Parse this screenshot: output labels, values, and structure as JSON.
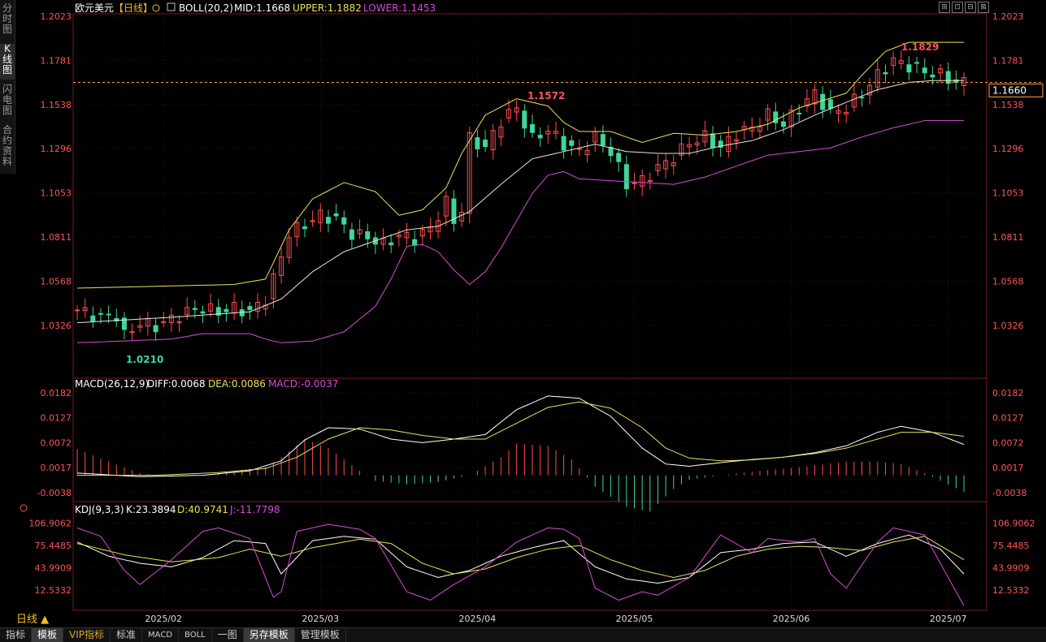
{
  "side_tabs": [
    "分时图",
    "K线图",
    "闪电图",
    "合约资料"
  ],
  "side_tabs_active": 1,
  "toolbar": [
    "⊞",
    "⊡",
    "⊟",
    "⊠"
  ],
  "header": {
    "symbol": "欧元美元",
    "period_tag": "【日线】",
    "boll_label": "BOLL(20,2)",
    "mid": "MID:1.1668",
    "upper": "UPPER:1.1882",
    "lower": "LOWER:1.1453"
  },
  "macd_header": {
    "label": "MACD(26,12,9)",
    "diff": "DIFF:0.0068",
    "dea": "DEA:0.0086",
    "macd": "MACD:-0.0037"
  },
  "kdj_header": {
    "label": "KDJ(9,3,3)",
    "k": "K:23.3894",
    "d": "D:40.9741",
    "j": "J:-11.7798"
  },
  "period_button": "日线 ▲",
  "bottom_tabs": [
    "指标",
    "模板",
    "VIP指标",
    "标准",
    "MACD",
    "BOLL",
    "一图",
    "另存模板",
    "管理模板"
  ],
  "colors": {
    "up": "#ff4d4d",
    "down": "#3ed69a",
    "boll_upper": "#e8e35a",
    "boll_mid": "#e8e8d0",
    "boll_lower": "#d84cd8",
    "dea": "#e8e35a",
    "diff": "#ffffff",
    "kdj_k": "#ffffff",
    "kdj_d": "#e8e35a",
    "kdj_j": "#d84cd8",
    "axis_text": "#ff5555",
    "last_price": "#ffa040"
  },
  "chart_data": [
    {
      "type": "candlestick",
      "title": "欧元美元 日线",
      "x_ticks": [
        "2025/02",
        "2025/03",
        "2025/04",
        "2025/05",
        "2025/06",
        "2025/07"
      ],
      "x_tick_index": [
        11,
        31,
        51,
        71,
        91,
        111
      ],
      "y_ticks": [
        "1.2023",
        "1.1781",
        "1.1538",
        "1.1296",
        "1.1053",
        "1.0811",
        "1.0568",
        "1.0326"
      ],
      "ylim": [
        1.0169,
        1.2023
      ],
      "last_price": "1.1660",
      "high_label": "1.1829",
      "low_label": "1.0210",
      "mid_high_label": "1.1572",
      "close_anchors": [
        [
          0,
          1.041
        ],
        [
          3,
          1.037
        ],
        [
          5,
          1.038
        ],
        [
          6,
          1.027
        ],
        [
          8,
          1.034
        ],
        [
          10,
          1.032
        ],
        [
          12,
          1.036
        ],
        [
          14,
          1.04
        ],
        [
          16,
          1.042
        ],
        [
          18,
          1.04
        ],
        [
          20,
          1.042
        ],
        [
          22,
          1.04
        ],
        [
          24,
          1.047
        ],
        [
          25,
          1.058
        ],
        [
          27,
          1.083
        ],
        [
          29,
          1.088
        ],
        [
          31,
          1.093
        ],
        [
          33,
          1.091
        ],
        [
          35,
          1.083
        ],
        [
          37,
          1.081
        ],
        [
          39,
          1.077
        ],
        [
          41,
          1.082
        ],
        [
          43,
          1.08
        ],
        [
          45,
          1.086
        ],
        [
          47,
          1.1
        ],
        [
          48,
          1.09
        ],
        [
          49,
          1.096
        ],
        [
          50,
          1.135
        ],
        [
          52,
          1.13
        ],
        [
          54,
          1.145
        ],
        [
          56,
          1.152
        ],
        [
          58,
          1.135
        ],
        [
          60,
          1.14
        ],
        [
          62,
          1.132
        ],
        [
          64,
          1.128
        ],
        [
          66,
          1.136
        ],
        [
          68,
          1.128
        ],
        [
          70,
          1.11
        ],
        [
          72,
          1.112
        ],
        [
          74,
          1.119
        ],
        [
          76,
          1.125
        ],
        [
          78,
          1.133
        ],
        [
          80,
          1.136
        ],
        [
          82,
          1.13
        ],
        [
          84,
          1.138
        ],
        [
          86,
          1.141
        ],
        [
          88,
          1.148
        ],
        [
          90,
          1.143
        ],
        [
          92,
          1.152
        ],
        [
          94,
          1.16
        ],
        [
          96,
          1.149
        ],
        [
          98,
          1.152
        ],
        [
          100,
          1.16
        ],
        [
          102,
          1.17
        ],
        [
          104,
          1.178
        ],
        [
          106,
          1.175
        ],
        [
          108,
          1.172
        ],
        [
          110,
          1.17
        ],
        [
          112,
          1.166
        ],
        [
          113,
          1.166
        ]
      ],
      "boll_upper_anchors": [
        [
          0,
          1.053
        ],
        [
          20,
          1.055
        ],
        [
          24,
          1.058
        ],
        [
          27,
          1.085
        ],
        [
          30,
          1.102
        ],
        [
          34,
          1.111
        ],
        [
          38,
          1.106
        ],
        [
          41,
          1.093
        ],
        [
          44,
          1.096
        ],
        [
          47,
          1.108
        ],
        [
          49,
          1.127
        ],
        [
          52,
          1.148
        ],
        [
          56,
          1.157
        ],
        [
          60,
          1.153
        ],
        [
          62,
          1.144
        ],
        [
          64,
          1.139
        ],
        [
          68,
          1.139
        ],
        [
          72,
          1.133
        ],
        [
          76,
          1.138
        ],
        [
          80,
          1.137
        ],
        [
          84,
          1.139
        ],
        [
          88,
          1.143
        ],
        [
          92,
          1.152
        ],
        [
          95,
          1.156
        ],
        [
          98,
          1.16
        ],
        [
          100,
          1.17
        ],
        [
          103,
          1.183
        ],
        [
          106,
          1.188
        ],
        [
          113,
          1.188
        ]
      ],
      "boll_mid_anchors": [
        [
          0,
          1.034
        ],
        [
          12,
          1.037
        ],
        [
          22,
          1.04
        ],
        [
          26,
          1.047
        ],
        [
          30,
          1.062
        ],
        [
          34,
          1.073
        ],
        [
          38,
          1.079
        ],
        [
          42,
          1.085
        ],
        [
          46,
          1.087
        ],
        [
          50,
          1.095
        ],
        [
          54,
          1.11
        ],
        [
          58,
          1.124
        ],
        [
          62,
          1.128
        ],
        [
          66,
          1.132
        ],
        [
          70,
          1.128
        ],
        [
          74,
          1.127
        ],
        [
          78,
          1.127
        ],
        [
          82,
          1.131
        ],
        [
          86,
          1.134
        ],
        [
          90,
          1.14
        ],
        [
          94,
          1.148
        ],
        [
          98,
          1.155
        ],
        [
          102,
          1.162
        ],
        [
          106,
          1.166
        ],
        [
          109,
          1.167
        ],
        [
          113,
          1.167
        ]
      ],
      "boll_lower_anchors": [
        [
          0,
          1.023
        ],
        [
          12,
          1.025
        ],
        [
          16,
          1.028
        ],
        [
          22,
          1.028
        ],
        [
          24,
          1.025
        ],
        [
          26,
          1.023
        ],
        [
          30,
          1.024
        ],
        [
          34,
          1.029
        ],
        [
          38,
          1.043
        ],
        [
          40,
          1.058
        ],
        [
          42,
          1.076
        ],
        [
          44,
          1.077
        ],
        [
          46,
          1.073
        ],
        [
          48,
          1.063
        ],
        [
          50,
          1.055
        ],
        [
          52,
          1.062
        ],
        [
          54,
          1.075
        ],
        [
          56,
          1.09
        ],
        [
          58,
          1.105
        ],
        [
          60,
          1.115
        ],
        [
          62,
          1.117
        ],
        [
          64,
          1.113
        ],
        [
          68,
          1.112
        ],
        [
          72,
          1.111
        ],
        [
          76,
          1.11
        ],
        [
          80,
          1.114
        ],
        [
          84,
          1.12
        ],
        [
          88,
          1.126
        ],
        [
          92,
          1.128
        ],
        [
          96,
          1.13
        ],
        [
          100,
          1.136
        ],
        [
          104,
          1.141
        ],
        [
          108,
          1.145
        ],
        [
          113,
          1.145
        ]
      ]
    },
    {
      "type": "macd",
      "y_ticks": [
        "0.0182",
        "0.0127",
        "0.0072",
        "0.0017",
        "-0.0038"
      ],
      "ylim": [
        -0.0058,
        0.0182
      ],
      "diff_anchors": [
        [
          0,
          0.0005
        ],
        [
          8,
          -0.0003
        ],
        [
          16,
          0.0
        ],
        [
          22,
          0.001
        ],
        [
          26,
          0.0032
        ],
        [
          29,
          0.0078
        ],
        [
          32,
          0.0105
        ],
        [
          36,
          0.0102
        ],
        [
          40,
          0.008
        ],
        [
          44,
          0.0072
        ],
        [
          48,
          0.008
        ],
        [
          52,
          0.009
        ],
        [
          56,
          0.0145
        ],
        [
          60,
          0.0175
        ],
        [
          64,
          0.017
        ],
        [
          68,
          0.013
        ],
        [
          72,
          0.006
        ],
        [
          75,
          0.0025
        ],
        [
          78,
          0.002
        ],
        [
          82,
          0.0028
        ],
        [
          86,
          0.0035
        ],
        [
          90,
          0.004
        ],
        [
          94,
          0.005
        ],
        [
          98,
          0.0065
        ],
        [
          102,
          0.0095
        ],
        [
          105,
          0.0108
        ],
        [
          109,
          0.0095
        ],
        [
          113,
          0.0068
        ]
      ],
      "dea_anchors": [
        [
          0,
          0.0
        ],
        [
          10,
          0.0
        ],
        [
          18,
          0.0006
        ],
        [
          24,
          0.0015
        ],
        [
          28,
          0.004
        ],
        [
          32,
          0.008
        ],
        [
          36,
          0.0105
        ],
        [
          40,
          0.01
        ],
        [
          44,
          0.0088
        ],
        [
          48,
          0.008
        ],
        [
          52,
          0.008
        ],
        [
          56,
          0.0115
        ],
        [
          60,
          0.015
        ],
        [
          64,
          0.0162
        ],
        [
          68,
          0.0148
        ],
        [
          72,
          0.0105
        ],
        [
          75,
          0.006
        ],
        [
          78,
          0.0038
        ],
        [
          82,
          0.0032
        ],
        [
          86,
          0.0034
        ],
        [
          90,
          0.004
        ],
        [
          94,
          0.0048
        ],
        [
          98,
          0.006
        ],
        [
          102,
          0.008
        ],
        [
          105,
          0.0095
        ],
        [
          109,
          0.0095
        ],
        [
          113,
          0.0086
        ]
      ],
      "macd_anchors": [
        [
          0,
          0.0058
        ],
        [
          4,
          0.003
        ],
        [
          8,
          0.0005
        ],
        [
          12,
          -0.0003
        ],
        [
          16,
          0.0
        ],
        [
          20,
          0.001
        ],
        [
          24,
          0.0018
        ],
        [
          26,
          0.004
        ],
        [
          29,
          0.008
        ],
        [
          32,
          0.006
        ],
        [
          36,
          0.001
        ],
        [
          38,
          -0.0012
        ],
        [
          42,
          -0.002
        ],
        [
          46,
          -0.0015
        ],
        [
          50,
          0.0
        ],
        [
          54,
          0.004
        ],
        [
          56,
          0.007
        ],
        [
          60,
          0.0065
        ],
        [
          63,
          0.0035
        ],
        [
          66,
          -0.0025
        ],
        [
          70,
          -0.007
        ],
        [
          73,
          -0.008
        ],
        [
          76,
          -0.003
        ],
        [
          78,
          -0.001
        ],
        [
          82,
          0.0
        ],
        [
          86,
          0.0008
        ],
        [
          92,
          0.0018
        ],
        [
          98,
          0.003
        ],
        [
          102,
          0.003
        ],
        [
          105,
          0.0025
        ],
        [
          108,
          0.0005
        ],
        [
          113,
          -0.0037
        ]
      ]
    },
    {
      "type": "kdj",
      "y_ticks": [
        "106.9062",
        "75.4485",
        "43.9909",
        "12.5332"
      ],
      "ylim": [
        -11.78,
        113.0
      ],
      "k_anchors": [
        [
          0,
          80
        ],
        [
          4,
          60
        ],
        [
          8,
          50
        ],
        [
          12,
          45
        ],
        [
          16,
          58
        ],
        [
          20,
          82
        ],
        [
          24,
          78
        ],
        [
          26,
          35
        ],
        [
          30,
          82
        ],
        [
          34,
          88
        ],
        [
          38,
          84
        ],
        [
          42,
          45
        ],
        [
          46,
          30
        ],
        [
          50,
          40
        ],
        [
          54,
          60
        ],
        [
          58,
          72
        ],
        [
          62,
          82
        ],
        [
          66,
          45
        ],
        [
          70,
          28
        ],
        [
          74,
          22
        ],
        [
          78,
          30
        ],
        [
          82,
          65
        ],
        [
          86,
          70
        ],
        [
          90,
          78
        ],
        [
          94,
          80
        ],
        [
          98,
          60
        ],
        [
          102,
          78
        ],
        [
          106,
          90
        ],
        [
          110,
          70
        ],
        [
          113,
          35
        ]
      ],
      "d_anchors": [
        [
          0,
          78
        ],
        [
          6,
          62
        ],
        [
          12,
          52
        ],
        [
          18,
          58
        ],
        [
          22,
          70
        ],
        [
          26,
          60
        ],
        [
          30,
          72
        ],
        [
          36,
          84
        ],
        [
          40,
          78
        ],
        [
          44,
          50
        ],
        [
          48,
          35
        ],
        [
          52,
          42
        ],
        [
          56,
          58
        ],
        [
          60,
          70
        ],
        [
          64,
          75
        ],
        [
          68,
          55
        ],
        [
          72,
          40
        ],
        [
          76,
          30
        ],
        [
          80,
          40
        ],
        [
          84,
          60
        ],
        [
          88,
          70
        ],
        [
          92,
          74
        ],
        [
          96,
          72
        ],
        [
          100,
          68
        ],
        [
          104,
          80
        ],
        [
          108,
          88
        ],
        [
          113,
          55
        ]
      ],
      "j_anchors": [
        [
          0,
          100
        ],
        [
          3,
          88
        ],
        [
          6,
          40
        ],
        [
          8,
          20
        ],
        [
          12,
          55
        ],
        [
          16,
          95
        ],
        [
          18,
          100
        ],
        [
          22,
          85
        ],
        [
          25,
          2
        ],
        [
          26,
          10
        ],
        [
          28,
          95
        ],
        [
          32,
          105
        ],
        [
          36,
          98
        ],
        [
          38,
          85
        ],
        [
          42,
          10
        ],
        [
          45,
          -2
        ],
        [
          48,
          20
        ],
        [
          52,
          45
        ],
        [
          56,
          80
        ],
        [
          60,
          100
        ],
        [
          62,
          98
        ],
        [
          64,
          85
        ],
        [
          66,
          15
        ],
        [
          69,
          -2
        ],
        [
          72,
          10
        ],
        [
          74,
          5
        ],
        [
          78,
          30
        ],
        [
          82,
          90
        ],
        [
          86,
          65
        ],
        [
          88,
          85
        ],
        [
          92,
          80
        ],
        [
          94,
          85
        ],
        [
          96,
          35
        ],
        [
          98,
          15
        ],
        [
          102,
          80
        ],
        [
          104,
          100
        ],
        [
          108,
          90
        ],
        [
          110,
          50
        ],
        [
          113,
          -10
        ]
      ]
    }
  ]
}
